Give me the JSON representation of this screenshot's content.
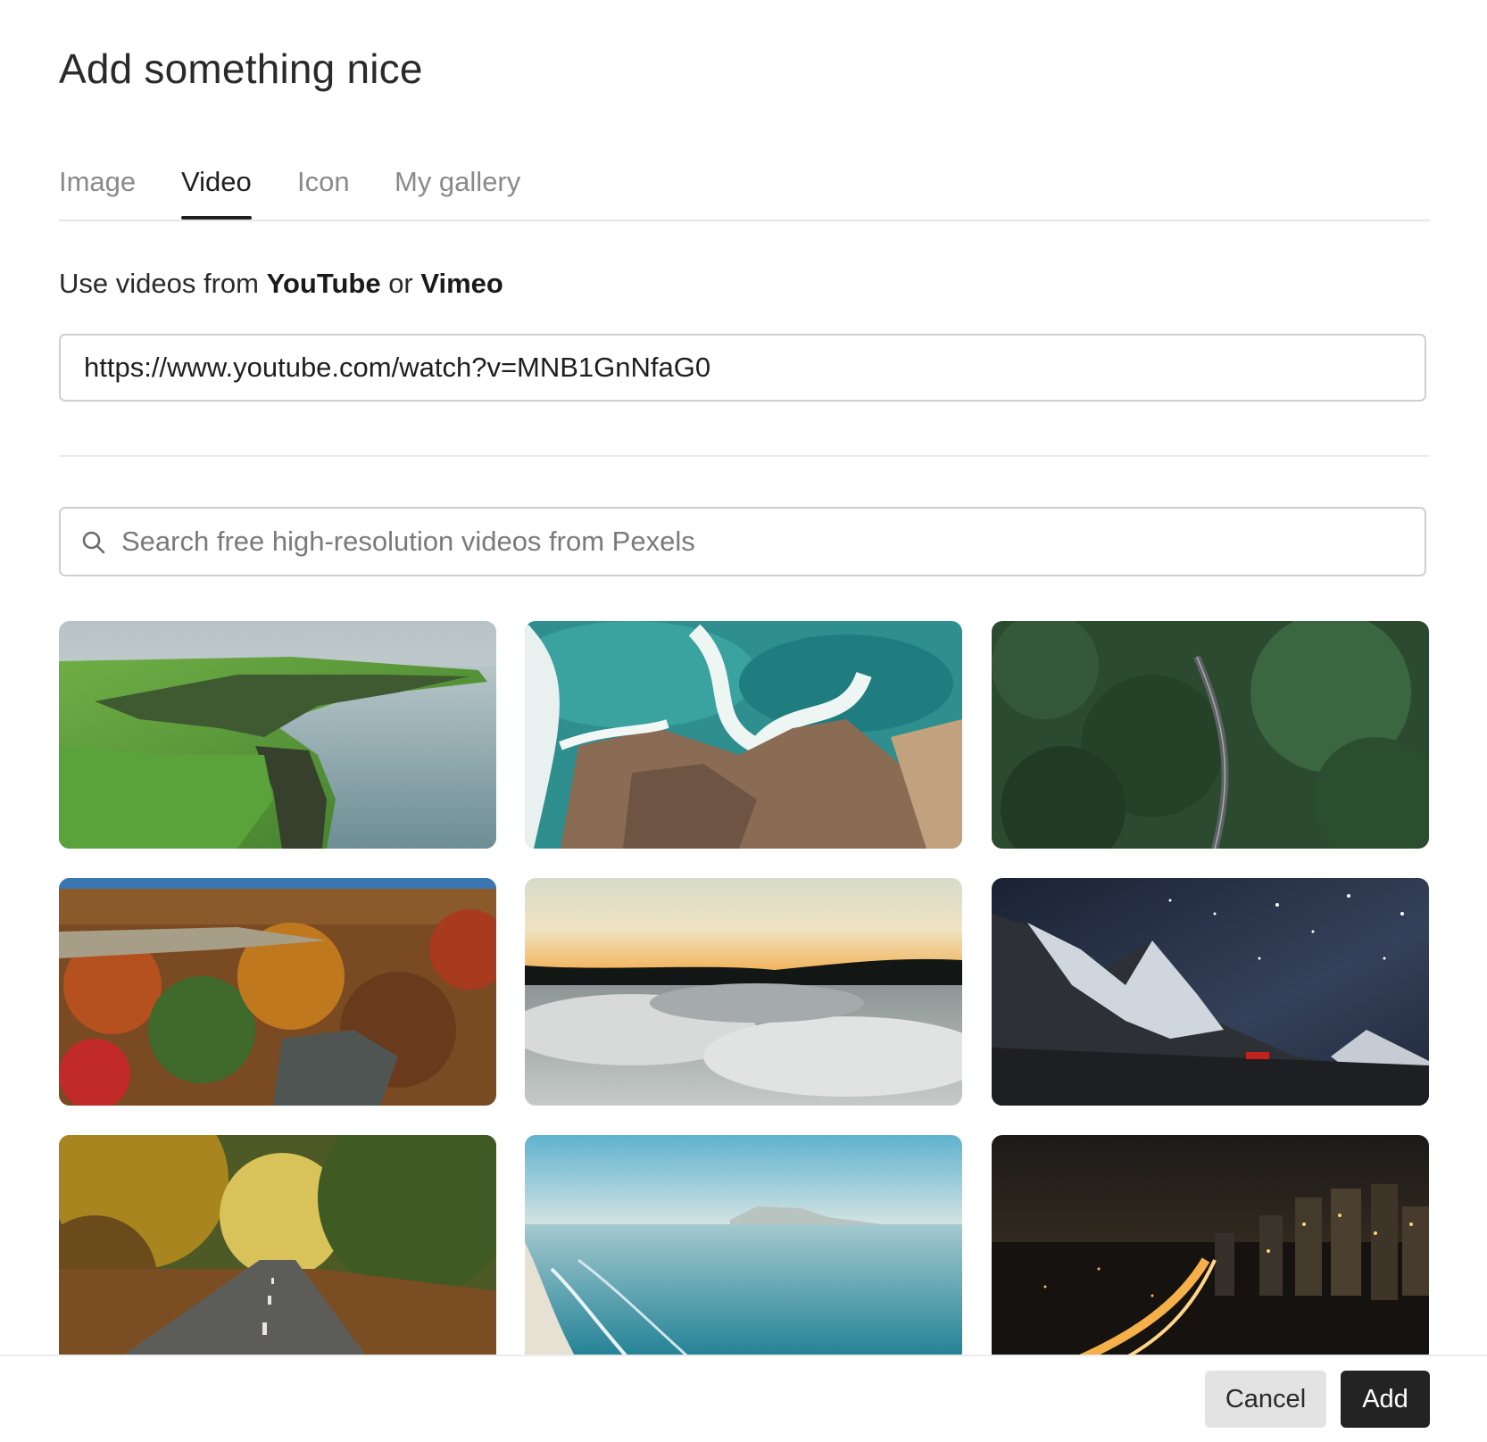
{
  "dialog": {
    "title": "Add something nice",
    "tabs": [
      {
        "label": "Image",
        "active": false
      },
      {
        "label": "Video",
        "active": true
      },
      {
        "label": "Icon",
        "active": false
      },
      {
        "label": "My gallery",
        "active": false
      }
    ],
    "source": {
      "prefix": "Use videos from ",
      "youtube": "YouTube",
      "or": " or ",
      "vimeo": "Vimeo"
    },
    "url_input": {
      "value": "https://www.youtube.com/watch?v=MNB1GnNfaG0",
      "placeholder": ""
    },
    "search": {
      "placeholder": "Search free high-resolution videos from Pexels",
      "icon": "search-icon"
    },
    "videos": [
      {
        "name": "video-thumb-sea-cliffs",
        "subject": "coastal cliffs"
      },
      {
        "name": "video-thumb-ocean-rocks",
        "subject": "waves on rocks"
      },
      {
        "name": "video-thumb-forest-road",
        "subject": "forest road"
      },
      {
        "name": "video-thumb-autumn-valley",
        "subject": "autumn valley"
      },
      {
        "name": "video-thumb-clouds-sunset",
        "subject": "clouds at sunset"
      },
      {
        "name": "video-thumb-night-mountain",
        "subject": "starry mountain"
      },
      {
        "name": "video-thumb-autumn-road",
        "subject": "autumn road"
      },
      {
        "name": "video-thumb-beach-coast",
        "subject": "beach coast"
      },
      {
        "name": "video-thumb-city-night",
        "subject": "city at night"
      }
    ],
    "footer": {
      "cancel_label": "Cancel",
      "add_label": "Add"
    }
  }
}
